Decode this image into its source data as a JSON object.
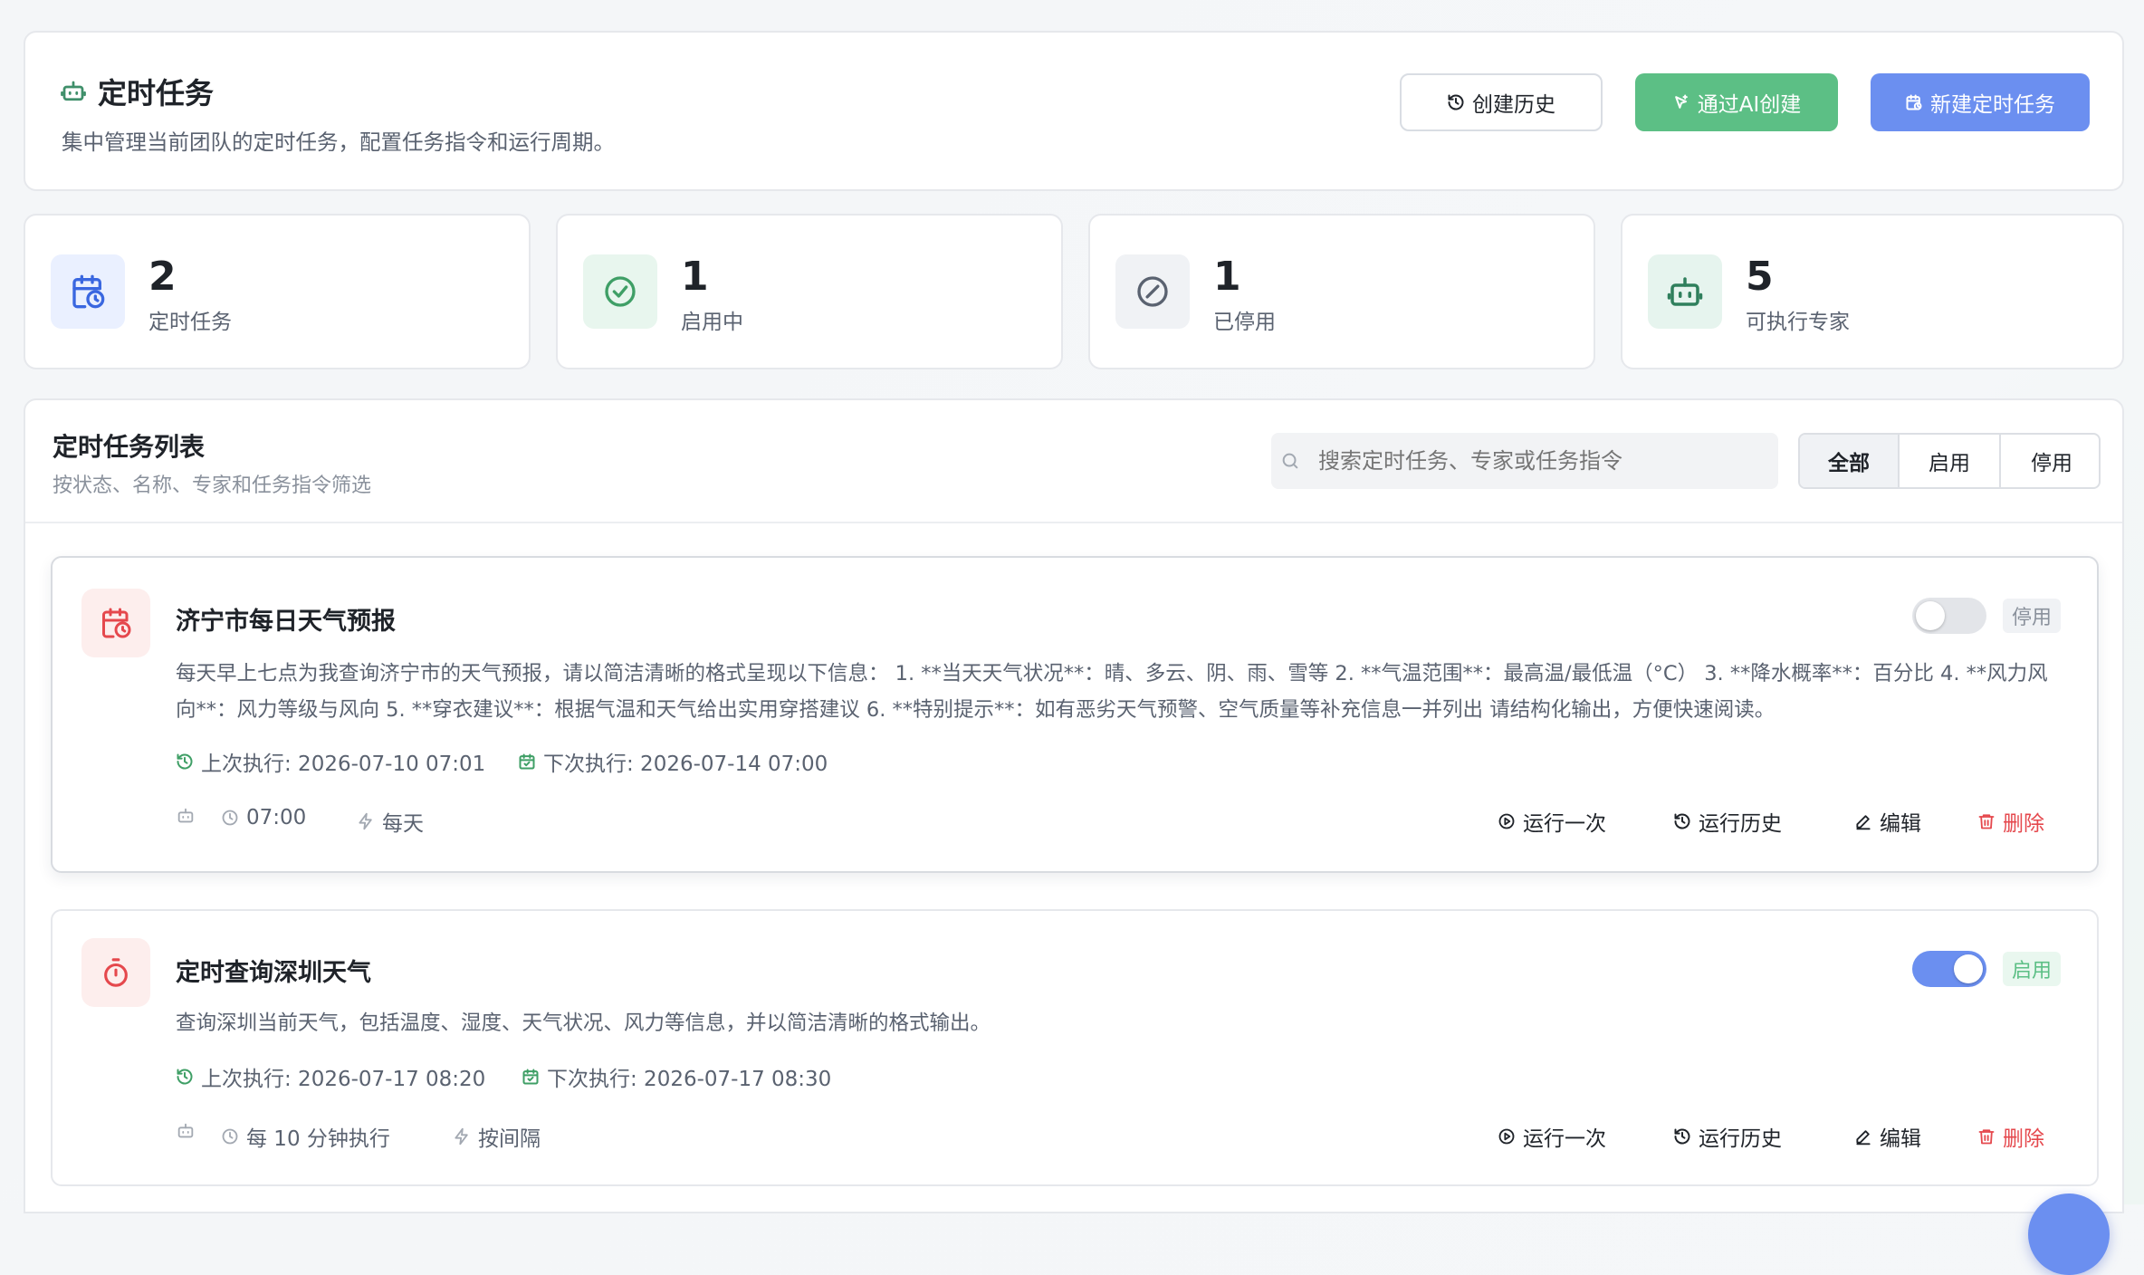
{
  "header": {
    "title": "定时任务",
    "subtitle": "集中管理当前团队的定时任务，配置任务指令和运行周期。",
    "history_button": "创建历史",
    "ai_button": "通过AI创建",
    "new_button": "新建定时任务"
  },
  "stats": [
    {
      "value": "2",
      "label": "定时任务"
    },
    {
      "value": "1",
      "label": "启用中"
    },
    {
      "value": "1",
      "label": "已停用"
    },
    {
      "value": "5",
      "label": "可执行专家"
    }
  ],
  "list": {
    "title": "定时任务列表",
    "subtitle": "按状态、名称、专家和任务指令筛选",
    "search_placeholder": "搜索定时任务、专家或任务指令",
    "filters": [
      "全部",
      "启用",
      "停用"
    ],
    "active_filter": "全部"
  },
  "tasks": [
    {
      "title": "济宁市每日天气预报",
      "enabled": false,
      "status_label": "停用",
      "description": "每天早上七点为我查询济宁市的天气预报，请以简洁清晰的格式呈现以下信息： 1. **当天天气状况**：晴、多云、阴、雨、雪等 2. **气温范围**：最高温/最低温（°C） 3. **降水概率**：百分比 4. **风力风向**：风力等级与风向 5. **穿衣建议**：根据气温和天气给出实用穿搭建议 6. **特别提示**：如有恶劣天气预警、空气质量等补充信息一并列出 请结构化输出，方便快速阅读。",
      "last_run": "上次执行: 2026-07-10 07:01",
      "next_run": "下次执行: 2026-07-14 07:00",
      "schedule": "07:00",
      "frequency": "每天",
      "icon": "calendar-clock-icon",
      "actions": {
        "run_once": "运行一次",
        "run_history": "运行历史",
        "edit": "编辑",
        "delete": "删除"
      }
    },
    {
      "title": "定时查询深圳天气",
      "enabled": true,
      "status_label": "启用",
      "description": "查询深圳当前天气，包括温度、湿度、天气状况、风力等信息，并以简洁清晰的格式输出。",
      "last_run": "上次执行: 2026-07-17 08:20",
      "next_run": "下次执行: 2026-07-17 08:30",
      "schedule": "每 10 分钟执行",
      "frequency": "按间隔",
      "icon": "timer-icon",
      "actions": {
        "run_once": "运行一次",
        "run_history": "运行历史",
        "edit": "编辑",
        "delete": "删除"
      }
    }
  ],
  "colors": {
    "accent_blue": "#6b8ff0",
    "accent_green": "#5cbf85",
    "danger_red": "#e5484d",
    "enabled_green": "#3f9f66"
  }
}
